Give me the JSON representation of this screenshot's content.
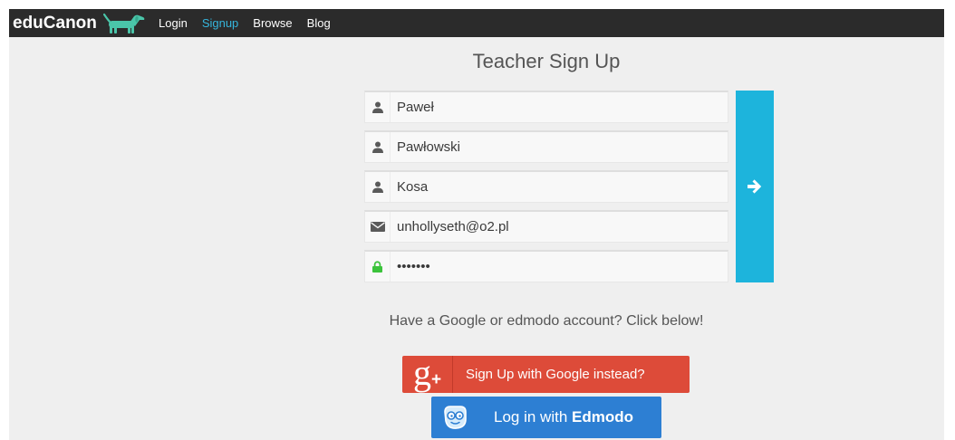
{
  "nav": {
    "brand": "eduCanon",
    "logo_icon": "dachshund-logo-icon",
    "links": [
      {
        "label": "Login",
        "active": false
      },
      {
        "label": "Signup",
        "active": true
      },
      {
        "label": "Browse",
        "active": false
      },
      {
        "label": "Blog",
        "active": false
      }
    ]
  },
  "page_title": "Teacher Sign Up",
  "form": {
    "fields": [
      {
        "icon": "user-icon",
        "value": "Paweł"
      },
      {
        "icon": "user-icon",
        "value": "Pawłowski"
      },
      {
        "icon": "user-icon",
        "value": "Kosa"
      },
      {
        "icon": "envelope-icon",
        "value": "unhollyseth@o2.pl"
      },
      {
        "icon": "lock-icon",
        "value": "•••••••"
      }
    ],
    "submit_icon": "arrow-right-icon"
  },
  "social": {
    "prompt": "Have a Google or edmodo account? Click below!",
    "google_button": {
      "icon": "google-plus-icon",
      "logo_text": "g+",
      "label": "Sign Up with Google instead?"
    },
    "edmodo_button": {
      "icon": "edmodo-icon",
      "label_prefix": "Log in with",
      "label_brand": "Edmodo"
    }
  },
  "colors": {
    "nav_bg": "#2b2b2b",
    "page_bg": "#efefef",
    "active_link": "#35b5dc",
    "logo": "#4ac5a9",
    "submit": "#1db4dc",
    "google": "#dd4b39",
    "edmodo": "#2d7fd3",
    "lock": "#3cc33c"
  }
}
